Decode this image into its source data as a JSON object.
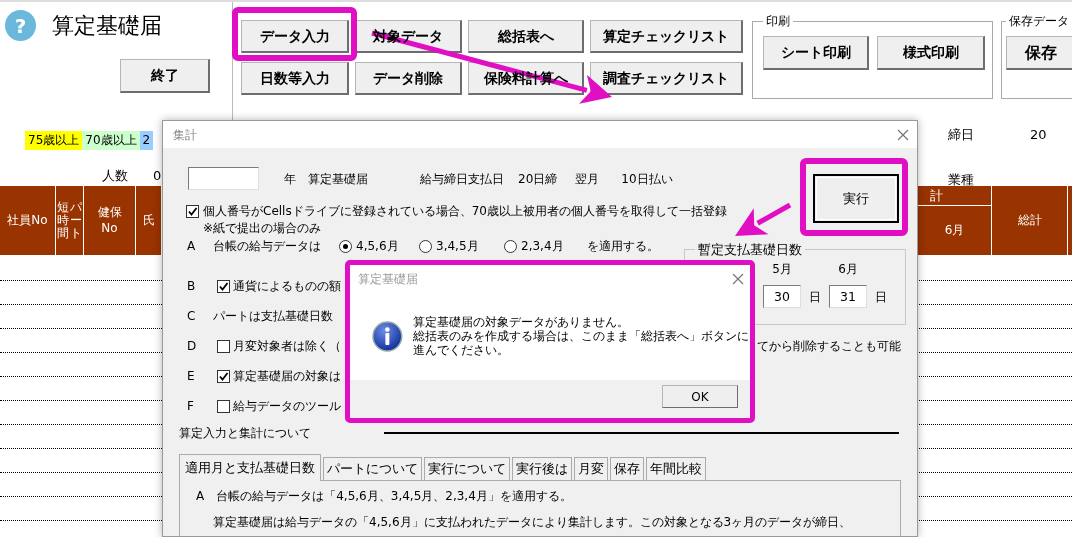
{
  "app": {
    "help": "?",
    "title": "算定基礎届",
    "exit_button": "終了"
  },
  "toolbar": {
    "rows": [
      [
        "データ入力",
        "対象データ",
        "総括表へ",
        "算定チェックリスト"
      ],
      [
        "日数等入力",
        "データ削除",
        "保険料計算へ",
        "調査チェックリスト"
      ]
    ]
  },
  "print_group": {
    "label": "印刷",
    "buttons": [
      "シート印刷",
      "様式印刷"
    ]
  },
  "save_group": {
    "label": "保存データ",
    "buttons": [
      "保存"
    ]
  },
  "legend": [
    {
      "label": "75歳以上",
      "color": "#ffff00"
    },
    {
      "label": "70歳以上",
      "color": "#ccffcc"
    },
    {
      "label": "2",
      "color": "#99ccff"
    }
  ],
  "count": {
    "label": "人数",
    "value": "0"
  },
  "info": [
    {
      "label": "締日",
      "value": "20"
    },
    {
      "label": "業種"
    }
  ],
  "table": {
    "left_columns": [
      {
        "label": "社員No"
      },
      {
        "label": "短時間",
        "label2": "パート",
        "kind": "vertical"
      },
      {
        "label": "健保No"
      },
      {
        "label": "氏"
      }
    ],
    "right_group": "計",
    "right_columns": [
      {
        "label": "6月",
        "kind": "sub"
      },
      {
        "label": "総計",
        "kind": "full"
      }
    ]
  },
  "dialog": {
    "title": "集計",
    "year_label": "年",
    "form_name": "算定基礎届",
    "pay_label": "給与締日支払日",
    "closing": "20日締",
    "month": "翌月",
    "payday": "10日払い",
    "execute_button": "実行",
    "personal_number": {
      "checked": true,
      "label": "個人番号がCellsドライブに登録されている場合、70歳以上被用者の個人番号を取得して一括登録",
      "note": "※紙で提出の場合のみ"
    },
    "options": [
      {
        "letter": "A",
        "kind": "radio",
        "label": "台帳の給与データは",
        "choices": [
          {
            "label": "4,5,6月",
            "selected": true
          },
          {
            "label": "3,4,5月",
            "selected": false
          },
          {
            "label": "2,3,4月",
            "selected": false
          }
        ],
        "suffix": "を適用する。"
      },
      {
        "letter": "B",
        "kind": "checkbox",
        "checked": true,
        "label": "通貨によるものの額"
      },
      {
        "letter": "C",
        "kind": "text",
        "label": "パートは支払基礎日数"
      },
      {
        "letter": "D",
        "kind": "checkbox",
        "checked": false,
        "label": "月変対象者は除く（",
        "trailing": "てから削除することも可能"
      },
      {
        "letter": "E",
        "kind": "checkbox",
        "checked": true,
        "label": "算定基礎届の対象は"
      },
      {
        "letter": "F",
        "kind": "checkbox",
        "checked": false,
        "label": "給与データのツール"
      }
    ],
    "base_days": {
      "title": "暫定支払基礎日数",
      "months": [
        {
          "label": "5月",
          "value": "30",
          "unit": "日"
        },
        {
          "label": "6月",
          "value": "31",
          "unit": "日"
        }
      ]
    },
    "help_section": {
      "title": "算定入力と集計について",
      "tabs": [
        {
          "label": "適用月と支払基礎日数",
          "selected": true
        },
        {
          "label": "パートについて",
          "selected": false
        },
        {
          "label": "実行について",
          "selected": false
        },
        {
          "label": "実行後は",
          "selected": false
        },
        {
          "label": "月変",
          "selected": false
        },
        {
          "label": "保存",
          "selected": false
        },
        {
          "label": "年間比較",
          "selected": false
        }
      ],
      "heading": "A　台帳の給与データは「4,5,6月、3,4,5月、2,3,4月」を適用する。",
      "paragraph": "算定基礎届は給与データの「4,5,6月」に支払われたデータにより集計します。この対象となる3ヶ月のデータが締日、"
    }
  },
  "message_box": {
    "title": "算定基礎届",
    "lines": [
      "算定基礎届の対象データがありません。",
      "総括表のみを作成する場合は、このまま「総括表へ」ボタンに進んでください。"
    ],
    "ok_button": "OK"
  }
}
